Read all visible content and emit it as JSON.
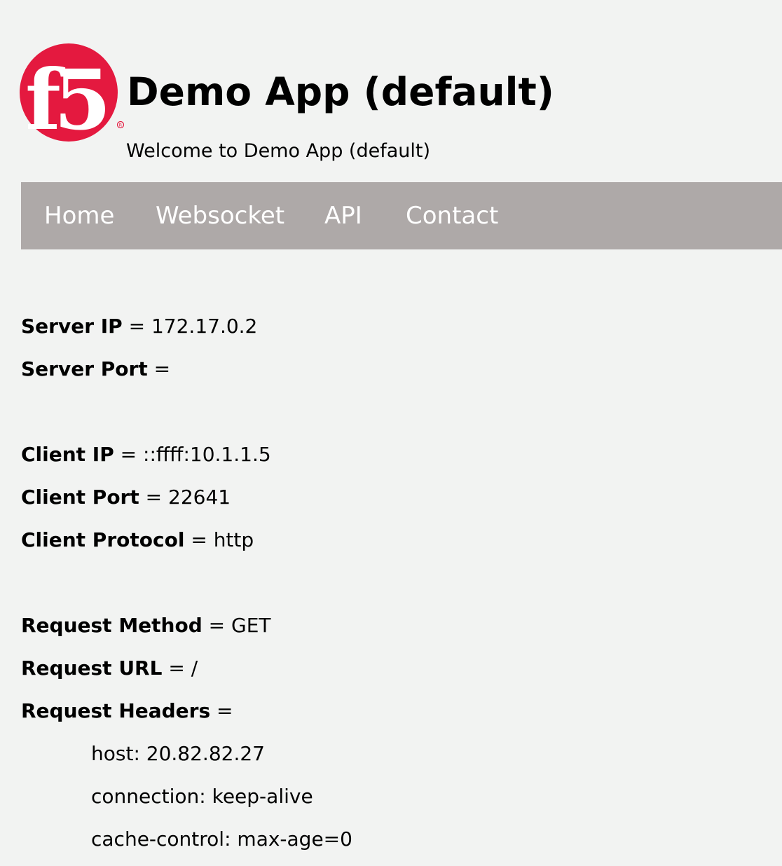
{
  "header": {
    "logo_text": "f5",
    "title": "Demo App (default)",
    "subtitle": "Welcome to Demo App (default)"
  },
  "nav": {
    "items": [
      {
        "label": "Home"
      },
      {
        "label": "Websocket"
      },
      {
        "label": "API"
      },
      {
        "label": "Contact"
      }
    ]
  },
  "server": {
    "ip_label": "Server IP",
    "ip_value": "172.17.0.2",
    "port_label": "Server Port",
    "port_value": ""
  },
  "client": {
    "ip_label": "Client IP",
    "ip_value": "::ffff:10.1.1.5",
    "port_label": "Client Port",
    "port_value": "22641",
    "protocol_label": "Client Protocol",
    "protocol_value": "http"
  },
  "request": {
    "method_label": "Request Method",
    "method_value": "GET",
    "url_label": "Request URL",
    "url_value": "/",
    "headers_label": "Request Headers",
    "headers": [
      {
        "text": "host: 20.82.82.27"
      },
      {
        "text": "connection: keep-alive"
      },
      {
        "text": "cache-control: max-age=0"
      }
    ]
  },
  "colors": {
    "background": "#f2f3f2",
    "navbar": "#aea9a8",
    "nav_text": "#ffffff",
    "logo_red": "#e4193f"
  }
}
